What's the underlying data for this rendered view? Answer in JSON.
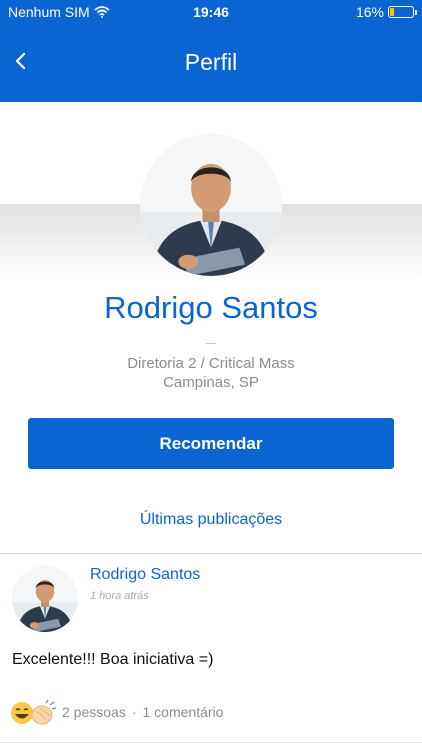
{
  "status_bar": {
    "carrier": "Nenhum SIM",
    "time": "19:46",
    "battery": "16%",
    "battery_level": 0.16
  },
  "header": {
    "title": "Perfil"
  },
  "profile": {
    "name": "Rodrigo Santos",
    "separator": "–",
    "department": "Diretoria 2 / Critical Mass",
    "location": "Campinas, SP"
  },
  "actions": {
    "recommend_label": "Recomendar"
  },
  "publications": {
    "heading": "Últimas publicações"
  },
  "post": {
    "author": "Rodrigo Santos",
    "time": "1 hora atrás",
    "text": "Excelente!!! Boa iniciativa =)",
    "likes": "2 pessoas",
    "dot": "·",
    "comments": "1 comentário"
  },
  "colors": {
    "brand": "#0a64d2",
    "muted": "#8c8c8c",
    "battery": "#f5c518"
  }
}
